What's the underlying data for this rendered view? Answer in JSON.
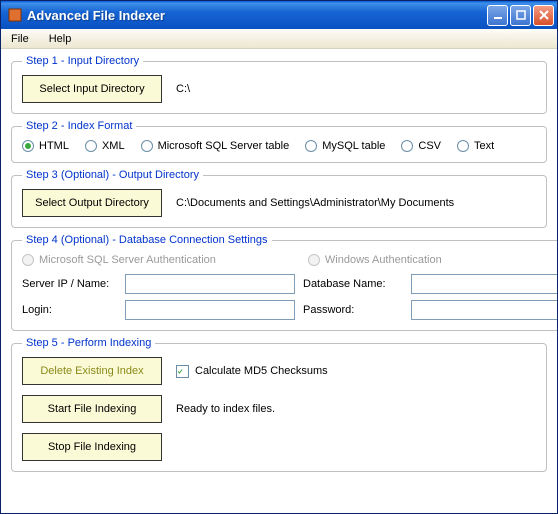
{
  "window": {
    "title": "Advanced File Indexer"
  },
  "menu": {
    "file": "File",
    "help": "Help"
  },
  "step1": {
    "legend": "Step 1 - Input Directory",
    "button": "Select Input Directory",
    "path": "C:\\"
  },
  "step2": {
    "legend": "Step 2 - Index Format",
    "selected": "HTML",
    "options": {
      "html": "HTML",
      "xml": "XML",
      "mssql": "Microsoft SQL Server table",
      "mysql": "MySQL table",
      "csv": "CSV",
      "text": "Text"
    }
  },
  "step3": {
    "legend": "Step 3 (Optional) - Output Directory",
    "button": "Select Output Directory",
    "path": "C:\\Documents and Settings\\Administrator\\My Documents"
  },
  "step4": {
    "legend": "Step 4 (Optional) - Database Connection Settings",
    "auth_options": {
      "sql": "Microsoft SQL Server Authentication",
      "win": "Windows Authentication"
    },
    "labels": {
      "server": "Server IP / Name:",
      "database": "Database Name:",
      "login": "Login:",
      "password": "Password:"
    },
    "values": {
      "server": "",
      "database": "",
      "login": "",
      "password": ""
    }
  },
  "step5": {
    "legend": "Step 5 - Perform Indexing",
    "delete_btn": "Delete Existing Index",
    "md5_label": "Calculate MD5 Checksums",
    "md5_checked": true,
    "start_btn": "Start File Indexing",
    "status": "Ready to index files.",
    "stop_btn": "Stop File Indexing"
  }
}
